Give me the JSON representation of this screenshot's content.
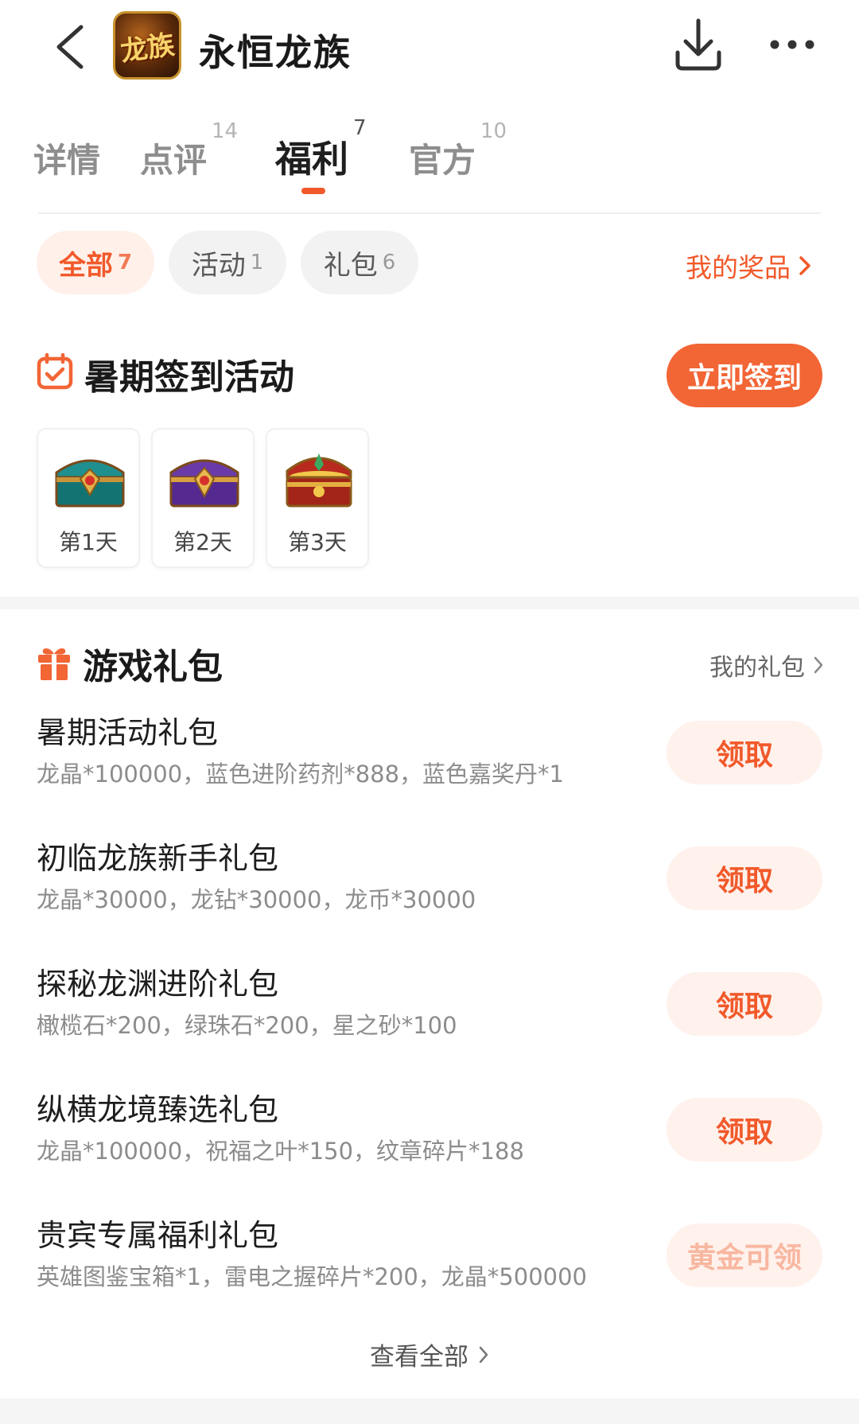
{
  "header": {
    "app_title": "永恒龙族",
    "logo_text": "龙族"
  },
  "tabs": [
    {
      "label": "详情",
      "count": ""
    },
    {
      "label": "点评",
      "count": "14"
    },
    {
      "label": "福利",
      "count": "7"
    },
    {
      "label": "官方",
      "count": "10"
    }
  ],
  "active_tab": "福利",
  "filters": [
    {
      "label": "全部",
      "count": "7"
    },
    {
      "label": "活动",
      "count": "1"
    },
    {
      "label": "礼包",
      "count": "6"
    }
  ],
  "active_filter": "全部",
  "my_prizes_label": "我的奖品",
  "signin": {
    "title": "暑期签到活动",
    "button_label": "立即签到",
    "days": [
      {
        "label": "第1天",
        "chest": "teal-chest"
      },
      {
        "label": "第2天",
        "chest": "purple-chest"
      },
      {
        "label": "第3天",
        "chest": "gold-chest"
      }
    ]
  },
  "gifts": {
    "title": "游戏礼包",
    "my_gifts_label": "我的礼包",
    "items": [
      {
        "name": "暑期活动礼包",
        "desc": "龙晶*100000，蓝色进阶药剂*888，蓝色嘉奖丹*1",
        "button": "领取",
        "enabled": true
      },
      {
        "name": "初临龙族新手礼包",
        "desc": "龙晶*30000，龙钻*30000，龙币*30000",
        "button": "领取",
        "enabled": true
      },
      {
        "name": "探秘龙渊进阶礼包",
        "desc": "橄榄石*200，绿珠石*200，星之砂*100",
        "button": "领取",
        "enabled": true
      },
      {
        "name": "纵横龙境臻选礼包",
        "desc": "龙晶*100000，祝福之叶*150，纹章碎片*188",
        "button": "领取",
        "enabled": true
      },
      {
        "name": "贵宾专属福利礼包",
        "desc": "英雄图鉴宝箱*1，雷电之握碎片*200，龙晶*500000",
        "button": "黄金可领",
        "enabled": false
      }
    ],
    "view_all_label": "查看全部"
  },
  "colors": {
    "accent": "#f1592a",
    "accent_bg": "#fff1ec",
    "chip_bg": "#f2f2f2",
    "text_muted": "#8c8c8c"
  }
}
